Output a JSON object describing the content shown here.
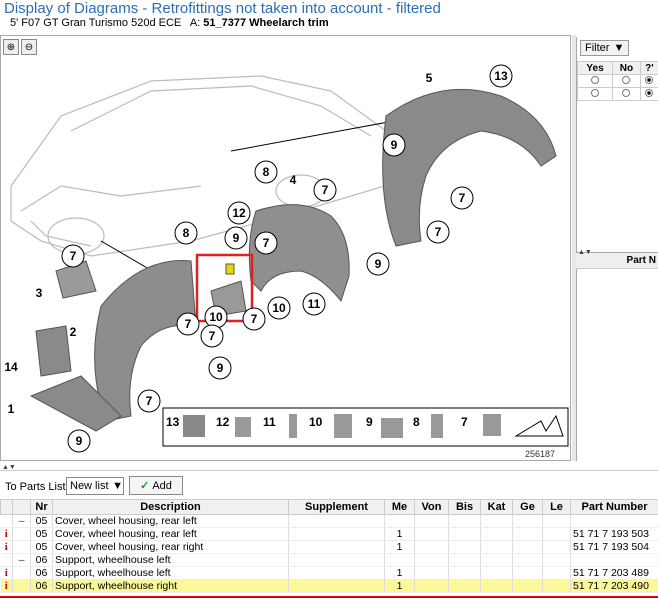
{
  "header": {
    "title": "Display of Diagrams - Retrofittings not taken into account - filtered",
    "vehicle": "5' F07 GT Gran Turismo 520d ECE",
    "group_prefix": "A:",
    "group_code": "51_7377",
    "group_name": "Wheelarch trim"
  },
  "diagram": {
    "image_number": "256187",
    "callouts": [
      "13",
      "5",
      "9",
      "7",
      "8",
      "4",
      "7",
      "12",
      "9",
      "7",
      "8",
      "7",
      "3",
      "2",
      "14",
      "1",
      "7",
      "10",
      "7",
      "10",
      "11",
      "9",
      "7",
      "9",
      "7",
      "9",
      "7"
    ],
    "legend": [
      "13",
      "12",
      "11",
      "10",
      "9",
      "8",
      "7"
    ]
  },
  "filter": {
    "button_label": "Filter",
    "columns": [
      "Yes",
      "No",
      "?'"
    ]
  },
  "parts_mini": {
    "header": "Part N"
  },
  "toolbar": {
    "to_parts_list_label": "To Parts List",
    "list_value": "New list",
    "add_label": "Add"
  },
  "parts_table": {
    "columns": [
      "Nr",
      "Description",
      "Supplement",
      "Me",
      "Von",
      "Bis",
      "Kat",
      "Ge",
      "Le",
      "Part Number"
    ],
    "rows": [
      {
        "icon": "",
        "dash": "–",
        "nr": "05",
        "desc": "Cover, wheel housing, rear left",
        "supp": "",
        "me": "",
        "pn": ""
      },
      {
        "icon": "i",
        "dash": "",
        "nr": "05",
        "desc": "Cover, wheel housing, rear left",
        "supp": "",
        "me": "1",
        "pn": "51 71 7 193 503"
      },
      {
        "icon": "i",
        "dash": "",
        "nr": "05",
        "desc": "Cover, wheel housing, rear right",
        "supp": "",
        "me": "1",
        "pn": "51 71 7 193 504"
      },
      {
        "icon": "",
        "dash": "–",
        "nr": "06",
        "desc": "Support, wheelhouse left",
        "supp": "",
        "me": "",
        "pn": ""
      },
      {
        "icon": "i",
        "dash": "",
        "nr": "06",
        "desc": "Support, wheelhouse left",
        "supp": "",
        "me": "1",
        "pn": "51 71 7 203 489"
      },
      {
        "icon": "i",
        "dash": "",
        "nr": "06",
        "desc": "Support, wheelhouse right",
        "supp": "",
        "me": "1",
        "pn": "51 71 7 203 490"
      }
    ]
  }
}
